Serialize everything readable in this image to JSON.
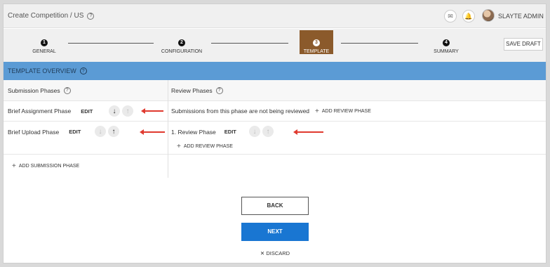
{
  "header": {
    "breadcrumb": "Create Competition / US",
    "user_name": "SLAYTE ADMIN"
  },
  "stepper": {
    "steps": [
      {
        "num": "1",
        "label": "GENERAL"
      },
      {
        "num": "2",
        "label": "CONFIGURATION"
      },
      {
        "num": "3",
        "label": "TEMPLATE"
      },
      {
        "num": "4",
        "label": "SUMMARY"
      }
    ],
    "active_step": 3,
    "save_draft_label": "SAVE DRAFT"
  },
  "overview": {
    "title": "TEMPLATE OVERVIEW"
  },
  "table": {
    "submission_header": "Submission Phases",
    "review_header": "Review Phases",
    "edit_label": "EDIT",
    "rows": [
      {
        "submission_phase": "Brief Assignment Phase",
        "review_text": "Submissions from this phase are not being reviewed",
        "add_review_label": "ADD REVIEW PHASE"
      },
      {
        "submission_phase": "Brief Upload Phase",
        "review_phase": "1. Review Phase",
        "add_review_label": "ADD REVIEW PHASE"
      }
    ],
    "add_submission_label": "ADD SUBMISSION PHASE"
  },
  "actions": {
    "back_label": "BACK",
    "next_label": "NEXT",
    "discard_label": "DISCARD"
  },
  "colors": {
    "overview_bar": "#5b9bd5",
    "active_step": "#8b5a2b",
    "next_button": "#1976d2",
    "annotation_arrow": "#e03a2f"
  }
}
